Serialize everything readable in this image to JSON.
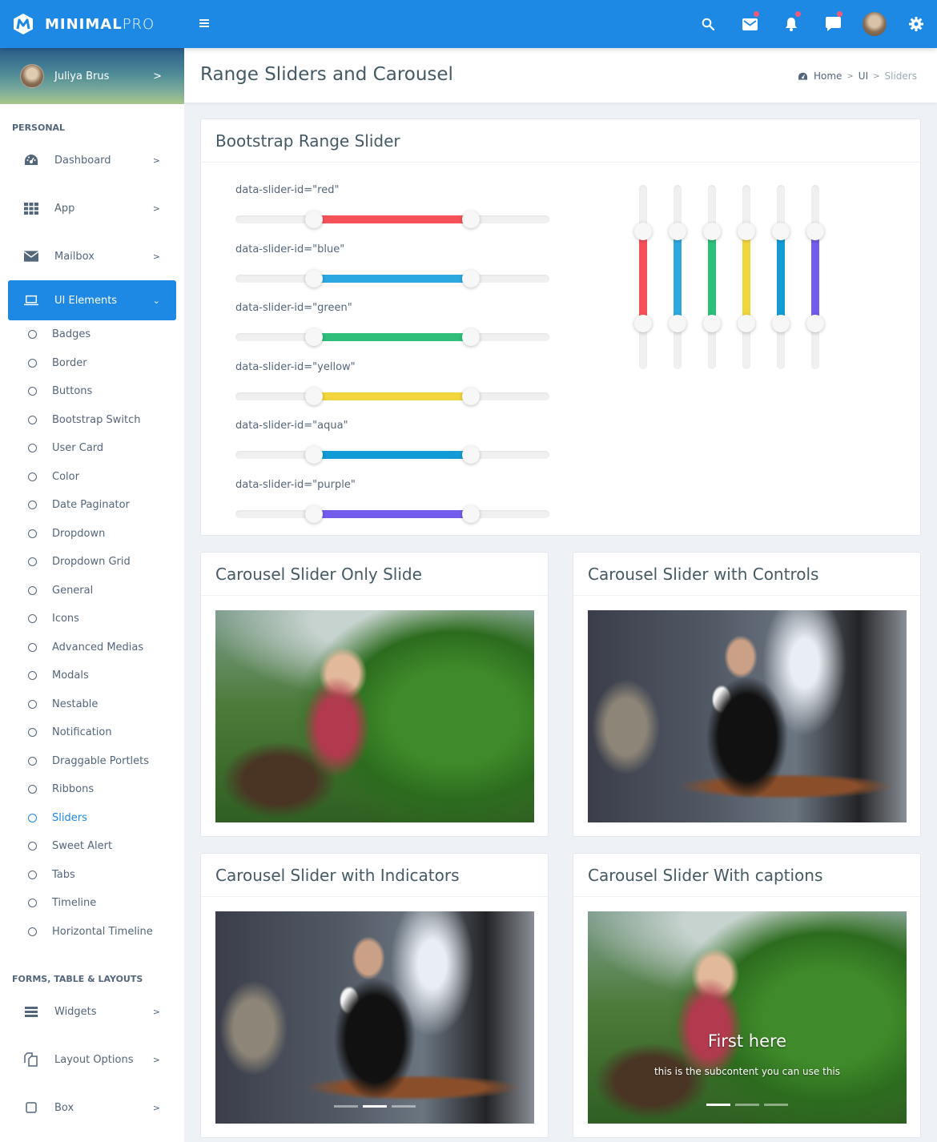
{
  "brand": {
    "name_bold": "MINIMAL",
    "name_light": "PRO"
  },
  "topbar": {
    "icons": [
      {
        "name": "search-icon",
        "badge": false
      },
      {
        "name": "mail-icon",
        "badge": true
      },
      {
        "name": "bell-icon",
        "badge": true
      },
      {
        "name": "chat-icon",
        "badge": true
      },
      {
        "name": "avatar",
        "badge": false
      },
      {
        "name": "gear-icon",
        "badge": false
      }
    ],
    "badge_color": "#ef5a78",
    "accent": "#1e88e5"
  },
  "user": {
    "name": "Juliya Brus",
    "chevron": ">"
  },
  "sidebar": {
    "caption_personal": "PERSONAL",
    "items": [
      {
        "label": "Dashboard",
        "icon": "dashboard-icon",
        "chevron": ">"
      },
      {
        "label": "App",
        "icon": "apps-grid-icon",
        "chevron": ">"
      },
      {
        "label": "Mailbox",
        "icon": "envelope-icon",
        "chevron": ">"
      },
      {
        "label": "UI Elements",
        "icon": "laptop-icon",
        "chevron": "⌄",
        "active": true
      }
    ],
    "sub_items": [
      "Badges",
      "Border",
      "Buttons",
      "Bootstrap Switch",
      "User Card",
      "Color",
      "Date Paginator",
      "Dropdown",
      "Dropdown Grid",
      "General",
      "Icons",
      "Advanced Medias",
      "Modals",
      "Nestable",
      "Notification",
      "Draggable Portlets",
      "Ribbons",
      "Sliders",
      "Sweet Alert",
      "Tabs",
      "Timeline",
      "Horizontal Timeline"
    ],
    "current_sub": "Sliders",
    "caption_forms": "FORMS, TABLE & LAYOUTS",
    "items2": [
      {
        "label": "Widgets",
        "icon": "list-icon",
        "chevron": ">"
      },
      {
        "label": "Layout Options",
        "icon": "copy-icon",
        "chevron": ">"
      },
      {
        "label": "Box",
        "icon": "square-icon",
        "chevron": ">"
      }
    ]
  },
  "page": {
    "title": "Range Sliders and Carousel",
    "breadcrumb": [
      "Home",
      "UI",
      "Sliders"
    ],
    "breadcrumb_sep": ">"
  },
  "range_card": {
    "title": "Bootstrap Range Slider",
    "horizontal_sliders": [
      {
        "label": "data-slider-id=\"red\"",
        "color": "#f65059",
        "min_pct": 25,
        "max_pct": 75
      },
      {
        "label": "data-slider-id=\"blue\"",
        "color": "#2ba8e0",
        "min_pct": 25,
        "max_pct": 75
      },
      {
        "label": "data-slider-id=\"green\"",
        "color": "#2fbf7a",
        "min_pct": 25,
        "max_pct": 75
      },
      {
        "label": "data-slider-id=\"yellow\"",
        "color": "#f2d43c",
        "min_pct": 25,
        "max_pct": 75
      },
      {
        "label": "data-slider-id=\"aqua\"",
        "color": "#139bd6",
        "min_pct": 25,
        "max_pct": 75
      },
      {
        "label": "data-slider-id=\"purple\"",
        "color": "#735bec",
        "min_pct": 25,
        "max_pct": 75
      }
    ],
    "vertical_sliders": [
      {
        "id": "red",
        "color": "#f65059",
        "min_pct": 25,
        "max_pct": 75
      },
      {
        "id": "blue",
        "color": "#2ba8e0",
        "min_pct": 25,
        "max_pct": 75
      },
      {
        "id": "green",
        "color": "#2fbf7a",
        "min_pct": 25,
        "max_pct": 75
      },
      {
        "id": "yellow",
        "color": "#f2d43c",
        "min_pct": 25,
        "max_pct": 75
      },
      {
        "id": "aqua",
        "color": "#139bd6",
        "min_pct": 25,
        "max_pct": 75
      },
      {
        "id": "purple",
        "color": "#735bec",
        "min_pct": 25,
        "max_pct": 75
      }
    ]
  },
  "carousels": [
    {
      "title": "Carousel Slider Only Slide",
      "image": "woman-garden",
      "indicators": null
    },
    {
      "title": "Carousel Slider with Controls",
      "image": "woman-cafe",
      "indicators": null
    },
    {
      "title": "Carousel Slider with Indicators",
      "image": "woman-cafe",
      "indicators": {
        "count": 3,
        "active": 1
      }
    },
    {
      "title": "Carousel Slider With captions",
      "image": "woman-garden",
      "indicators": {
        "count": 3,
        "active": 0
      },
      "caption_title": "First here",
      "caption_text": "this is the subcontent you can use this"
    }
  ]
}
